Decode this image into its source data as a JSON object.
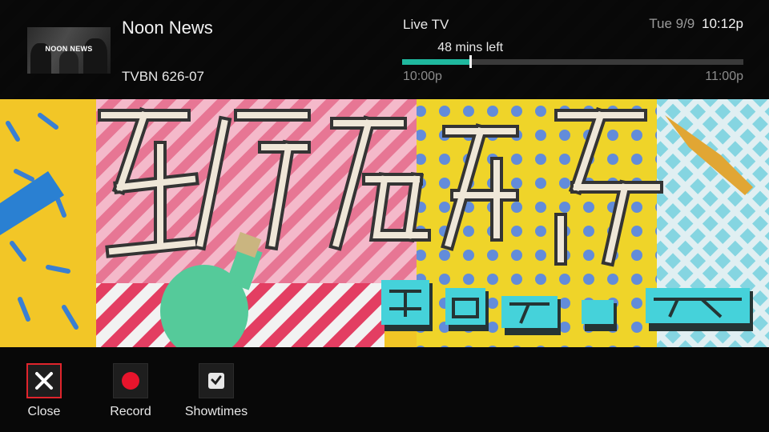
{
  "header": {
    "thumbnail_text": "NOON NEWS",
    "show_title": "Noon News",
    "channel": "TVBN 626-07",
    "mode_label": "Live TV",
    "date": "Tue 9/9",
    "clock": "10:12p",
    "time_left": "48 mins left",
    "start_time": "10:00p",
    "end_time": "11:00p",
    "progress_fraction": 0.2,
    "accent_color": "#1fb89e"
  },
  "actions": [
    {
      "label": "Close",
      "icon": "close-icon",
      "focused": true,
      "focus_color": "#e0242c"
    },
    {
      "label": "Record",
      "icon": "record-dot-icon",
      "focused": false,
      "icon_color": "#e8142c"
    },
    {
      "label": "Showtimes",
      "icon": "clock-icon",
      "focused": false
    }
  ]
}
